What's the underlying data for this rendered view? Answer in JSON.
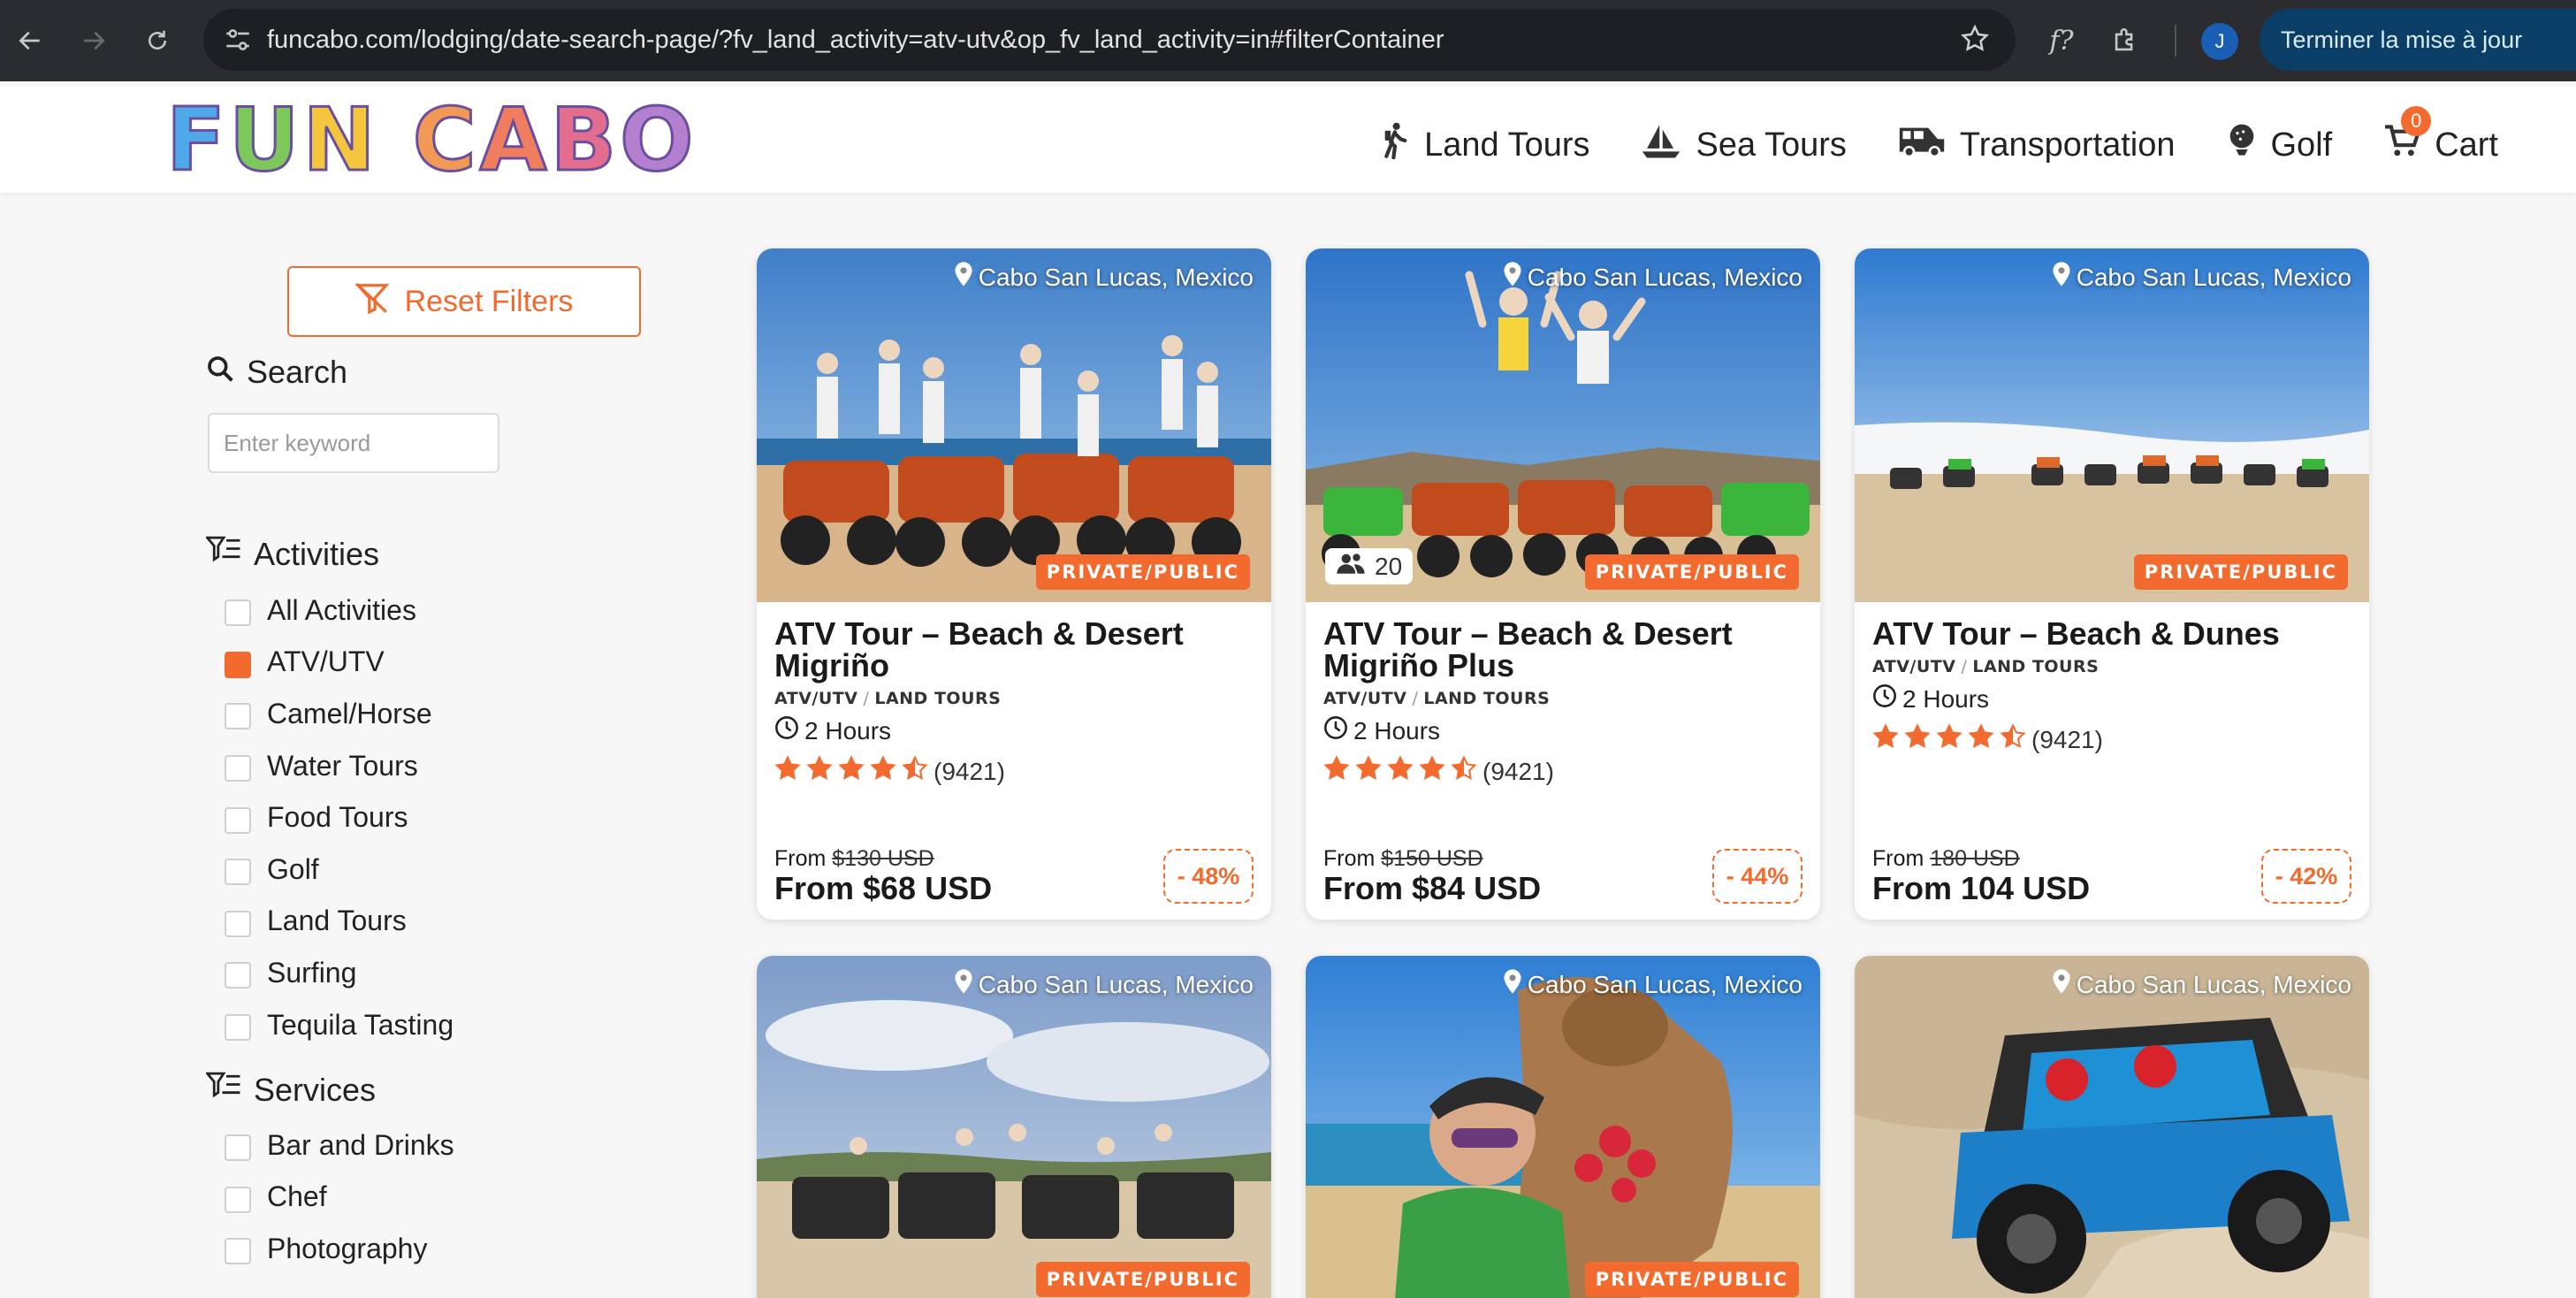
{
  "browser": {
    "url": "funcabo.com/lodging/date-search-page/?fv_land_activity=atv-utv&op_fv_land_activity=in#filterContainer",
    "profile_initial": "J",
    "update_label": "Terminer la mise à jour",
    "ext_label": "f?"
  },
  "brand": {
    "logo_text": "FUN CABO",
    "accent": "#f26a2e"
  },
  "nav": {
    "items": [
      {
        "label": "Land Tours",
        "icon": "hiking-icon"
      },
      {
        "label": "Sea Tours",
        "icon": "sailboat-icon"
      },
      {
        "label": "Transportation",
        "icon": "shuttle-icon"
      },
      {
        "label": "Golf",
        "icon": "golf-ball-icon"
      },
      {
        "label": "Cart",
        "icon": "cart-icon"
      }
    ],
    "cart_count": "0"
  },
  "filters": {
    "reset_label": "Reset Filters",
    "search_title": "Search",
    "search_placeholder": "Enter keyword",
    "activities_title": "Activities",
    "activities": [
      {
        "label": "All Activities",
        "checked": false
      },
      {
        "label": "ATV/UTV",
        "checked": true
      },
      {
        "label": "Camel/Horse",
        "checked": false
      },
      {
        "label": "Water Tours",
        "checked": false
      },
      {
        "label": "Food Tours",
        "checked": false
      },
      {
        "label": "Golf",
        "checked": false
      },
      {
        "label": "Land Tours",
        "checked": false
      },
      {
        "label": "Surfing",
        "checked": false
      },
      {
        "label": "Tequila Tasting",
        "checked": false
      }
    ],
    "services_title": "Services",
    "services": [
      {
        "label": "Bar and Drinks",
        "checked": false
      },
      {
        "label": "Chef",
        "checked": false
      },
      {
        "label": "Photography",
        "checked": false
      }
    ]
  },
  "cards": [
    {
      "location": "Cabo San Lucas, Mexico",
      "badge": "PRIVATE/PUBLIC",
      "title_line1": "ATV Tour – Beach & Desert",
      "title_line2": "Migriño",
      "cat1": "ATV/UTV",
      "cat2": "LAND TOURS",
      "duration": "2 Hours",
      "rating": 4.5,
      "reviews": "(9421)",
      "from_label": "From",
      "old_price": "$130 USD",
      "new_price": "From $68 USD",
      "discount": "- 48%"
    },
    {
      "location": "Cabo San Lucas, Mexico",
      "badge": "PRIVATE/PUBLIC",
      "pax": "20",
      "title_line1": "ATV Tour – Beach & Desert",
      "title_line2": "Migriño Plus",
      "cat1": "ATV/UTV",
      "cat2": "LAND TOURS",
      "duration": "2 Hours",
      "rating": 4.5,
      "reviews": "(9421)",
      "from_label": "From",
      "old_price": "$150 USD",
      "new_price": "From $84 USD",
      "discount": "- 44%"
    },
    {
      "location": "Cabo San Lucas, Mexico",
      "badge": "PRIVATE/PUBLIC",
      "title_line1": "ATV Tour – Beach & Dunes",
      "cat1": "ATV/UTV",
      "cat2": "LAND TOURS",
      "duration": "2 Hours",
      "rating": 4.5,
      "reviews": "(9421)",
      "from_label": "From",
      "old_price": "180 USD",
      "new_price": "From 104 USD",
      "discount": "- 42%"
    },
    {
      "location": "Cabo San Lucas, Mexico",
      "badge": "PRIVATE/PUBLIC"
    },
    {
      "location": "Cabo San Lucas, Mexico",
      "badge": "PRIVATE/PUBLIC"
    },
    {
      "location": "Cabo San Lucas, Mexico"
    }
  ]
}
